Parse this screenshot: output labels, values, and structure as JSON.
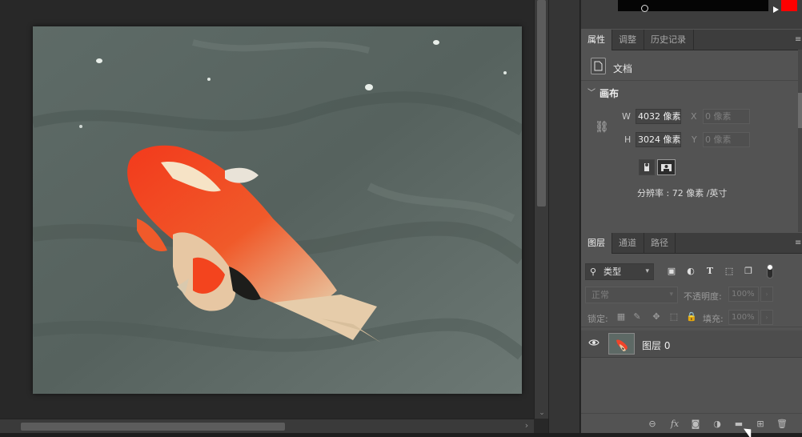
{
  "properties_panel": {
    "tabs": [
      {
        "label": "属性",
        "active": true
      },
      {
        "label": "调整",
        "active": false
      },
      {
        "label": "历史记录",
        "active": false
      }
    ],
    "doc_label": "文档",
    "canvas_section": "画布",
    "w_label": "W",
    "w_value": "4032 像素",
    "h_label": "H",
    "h_value": "3024 像素",
    "x_label": "X",
    "x_value": "0 像素",
    "y_label": "Y",
    "y_value": "0 像素",
    "resolution": "分辨率 : 72 像素 /英寸"
  },
  "layers_panel": {
    "tabs": [
      {
        "label": "图层",
        "active": true
      },
      {
        "label": "通道",
        "active": false
      },
      {
        "label": "路径",
        "active": false
      }
    ],
    "filter_label": "类型",
    "blend_mode": "正常",
    "opacity_label": "不透明度:",
    "opacity_value": "100%",
    "lock_label": "锁定:",
    "fill_label": "填充:",
    "fill_value": "100%",
    "layer": {
      "name": "图层",
      "index": "0",
      "visible": true
    }
  },
  "colors": {
    "panel_bg": "#535353",
    "tab_bar_bg": "#3d3d3d",
    "workspace_bg": "#282828",
    "swatch_red": "#ff0000"
  },
  "icons": {
    "filter_icons": [
      "image-filter-icon",
      "adjustment-filter-icon",
      "type-filter-icon",
      "shape-filter-icon",
      "smart-object-filter-icon"
    ],
    "lock_icons": [
      "lock-transparent-icon",
      "lock-paint-icon",
      "lock-position-icon",
      "lock-artboard-icon",
      "lock-all-icon"
    ],
    "footer_icons": [
      "link-layers-icon",
      "fx-icon",
      "mask-icon",
      "adjustment-layer-icon",
      "group-icon",
      "new-layer-icon",
      "delete-icon"
    ]
  }
}
